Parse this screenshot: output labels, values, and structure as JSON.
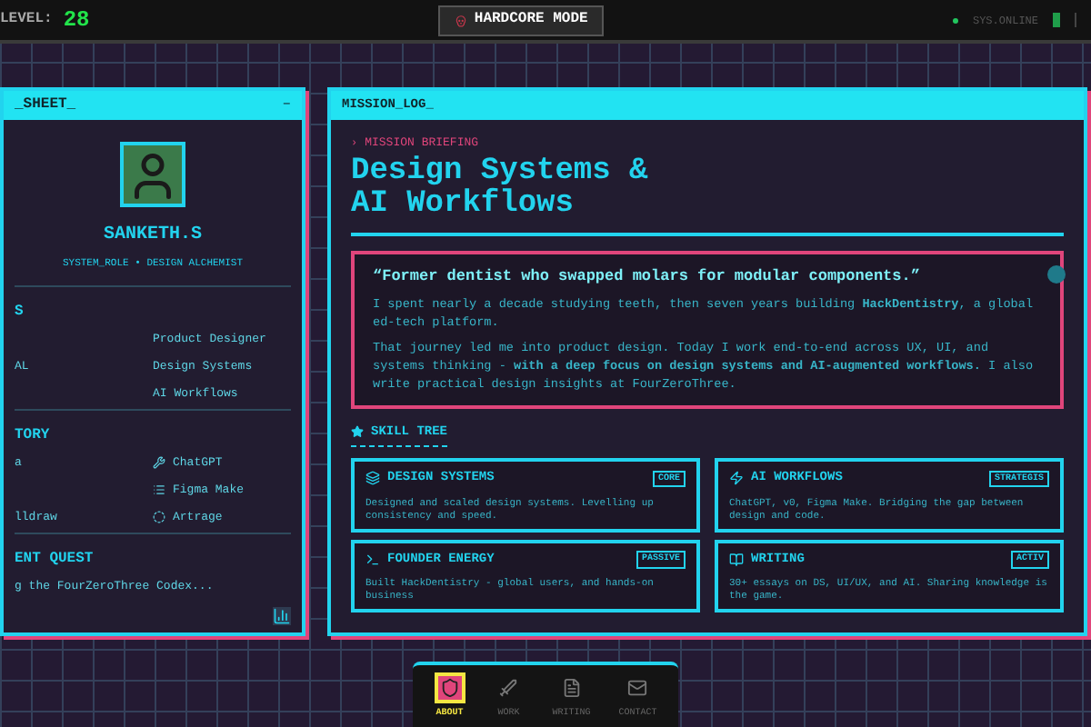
{
  "top_bar": {
    "level_label": "LEVEL:",
    "level_value": "28",
    "mode_button": "HARDCORE MODE",
    "status": "SYS.ONLINE"
  },
  "character_panel": {
    "title": "_SHEET_",
    "minimize": "–",
    "name": "SANKETH.S",
    "role": "SYSTEM_ROLE • DESIGN ALCHEMIST",
    "sections": [
      {
        "heading": "S",
        "rows": [
          {
            "value": "Product Designer"
          },
          {
            "left": "AL",
            "value": "Design Systems"
          },
          {
            "value": "AI Workflows"
          }
        ],
        "kind": "plain"
      },
      {
        "heading": "TORY",
        "rows": [
          {
            "left": "a",
            "value": "ChatGPT"
          },
          {
            "value": "Figma Make"
          },
          {
            "left": "lldraw",
            "value": "Artrage"
          }
        ],
        "kind": "tools"
      }
    ],
    "quest": {
      "heading": "ENT QUEST",
      "text": "g the FourZeroThree Codex..."
    }
  },
  "mission_panel": {
    "title": "MISSION_LOG_",
    "eyebrow_marker": "›",
    "eyebrow": "MISSION BRIEFING",
    "heading_lines": [
      "Design Systems &",
      "AI Workflows"
    ],
    "quote": "“Former dentist who swapped molars for modular components.”",
    "paragraphs": [
      "I spent nearly a decade studying teeth, then seven years building **HackDentistry**, a global ed-tech platform.",
      "That journey led me into product design. Today I work end-to-end across UX, UI, and systems thinking - **with a deep focus on design systems and AI-augmented workflows.** I also write practical design insights at FourZeroThree."
    ],
    "skill_tree_heading": "SKILL TREE",
    "skills": [
      {
        "title": "DESIGN SYSTEMS",
        "badge": "CORE",
        "text": "Designed and scaled design systems. Levelling up consistency and speed."
      },
      {
        "title": "AI WORKFLOWS",
        "badge": "STRATEGIS",
        "text": "ChatGPT, v0, Figma Make. Bridging the gap between design and code."
      },
      {
        "title": "FOUNDER ENERGY",
        "badge": "PASSIVE",
        "text": "Built HackDentistry - global users, and hands-on business"
      },
      {
        "title": "WRITING",
        "badge": "ACTIV",
        "text": "30+ essays on DS, UI/UX, and AI. Sharing knowledge is the game."
      }
    ]
  },
  "bottom_nav": [
    {
      "label": "ABOUT",
      "selected": true
    },
    {
      "label": "WORK",
      "selected": false
    },
    {
      "label": "WRITING",
      "selected": false
    },
    {
      "label": "CONTACT",
      "selected": false
    }
  ]
}
